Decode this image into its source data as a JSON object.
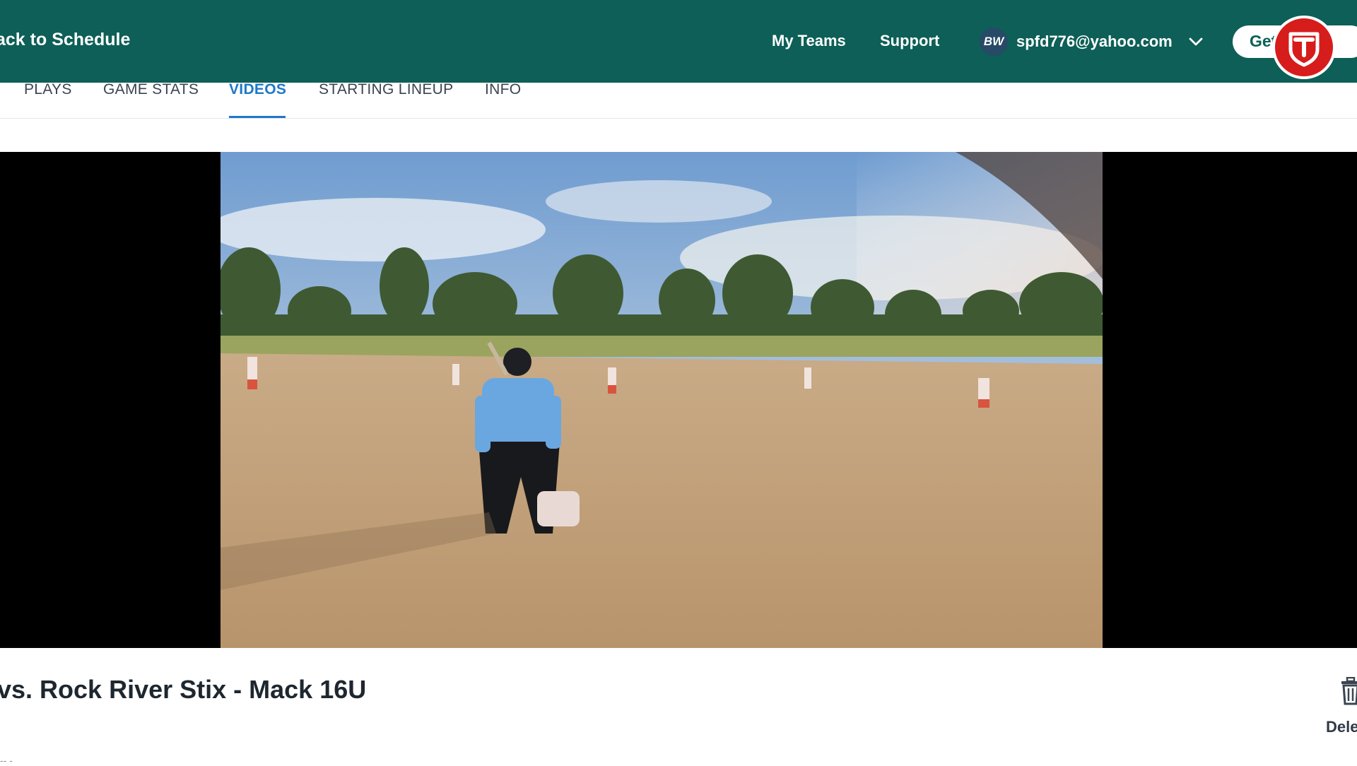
{
  "header": {
    "back_label": "ack to Schedule",
    "nav": {
      "my_teams": "My Teams",
      "support": "Support"
    },
    "user": {
      "initials": "BW",
      "email": "spfd776@yahoo.com"
    },
    "get_app_label": "Get",
    "icons": {
      "dropdown": "chevron-down-icon",
      "record": "shield-record-icon"
    }
  },
  "tabs": [
    {
      "label": "PLAYS",
      "active": false
    },
    {
      "label": "GAME STATS",
      "active": false
    },
    {
      "label": "VIDEOS",
      "active": true
    },
    {
      "label": "STARTING LINEUP",
      "active": false
    },
    {
      "label": "INFO",
      "active": false
    }
  ],
  "video": {
    "title": "vs. Rock River Stix - Mack 16U",
    "delete_label": "Dele",
    "sub_text": "-- -"
  },
  "colors": {
    "topbar": "#0d5f57",
    "accent": "#1f78c8",
    "record_badge": "#d71c1c"
  }
}
